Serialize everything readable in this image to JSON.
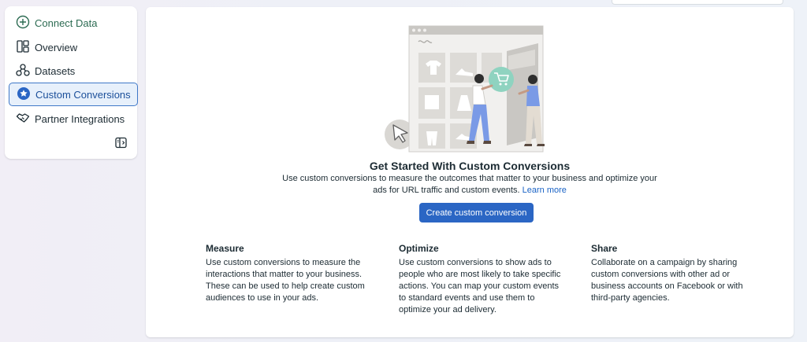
{
  "sidebar": {
    "items": [
      {
        "label": "Connect Data",
        "icon": "plus-circle-icon"
      },
      {
        "label": "Overview",
        "icon": "dashboard-layout-icon"
      },
      {
        "label": "Datasets",
        "icon": "datasets-nodes-icon"
      },
      {
        "label": "Custom Conversions",
        "icon": "star-badge-icon",
        "active": true
      },
      {
        "label": "Partner Integrations",
        "icon": "handshake-icon"
      }
    ],
    "collapse_icon": "sidebar-toggle-icon"
  },
  "main": {
    "title": "Get Started With Custom Conversions",
    "description": "Use custom conversions to measure the outcomes that matter to your business and optimize your ads for URL traffic and custom events.",
    "learn_more": "Learn more",
    "create_button": "Create custom conversion",
    "features": [
      {
        "title": "Measure",
        "text": "Use custom conversions to measure the interactions that matter to your business. These can be used to help create custom audiences to use in your ads."
      },
      {
        "title": "Optimize",
        "text": "Use custom conversions to show ads to people who are most likely to take specific actions. You can map your custom events to standard events and use them to optimize your ad delivery."
      },
      {
        "title": "Share",
        "text": "Collaborate on a campaign by sharing custom conversions with other ad or business accounts on Facebook or with third-party agencies."
      }
    ]
  },
  "colors": {
    "accent": "#2b66c4",
    "link": "#1a63c6",
    "active_bg": "#e7f0fb",
    "active_border": "#3f78c8",
    "connect_green": "#2c6b52",
    "illustration_mint": "#8fd3c0",
    "illustration_blue": "#7a9ae6"
  }
}
